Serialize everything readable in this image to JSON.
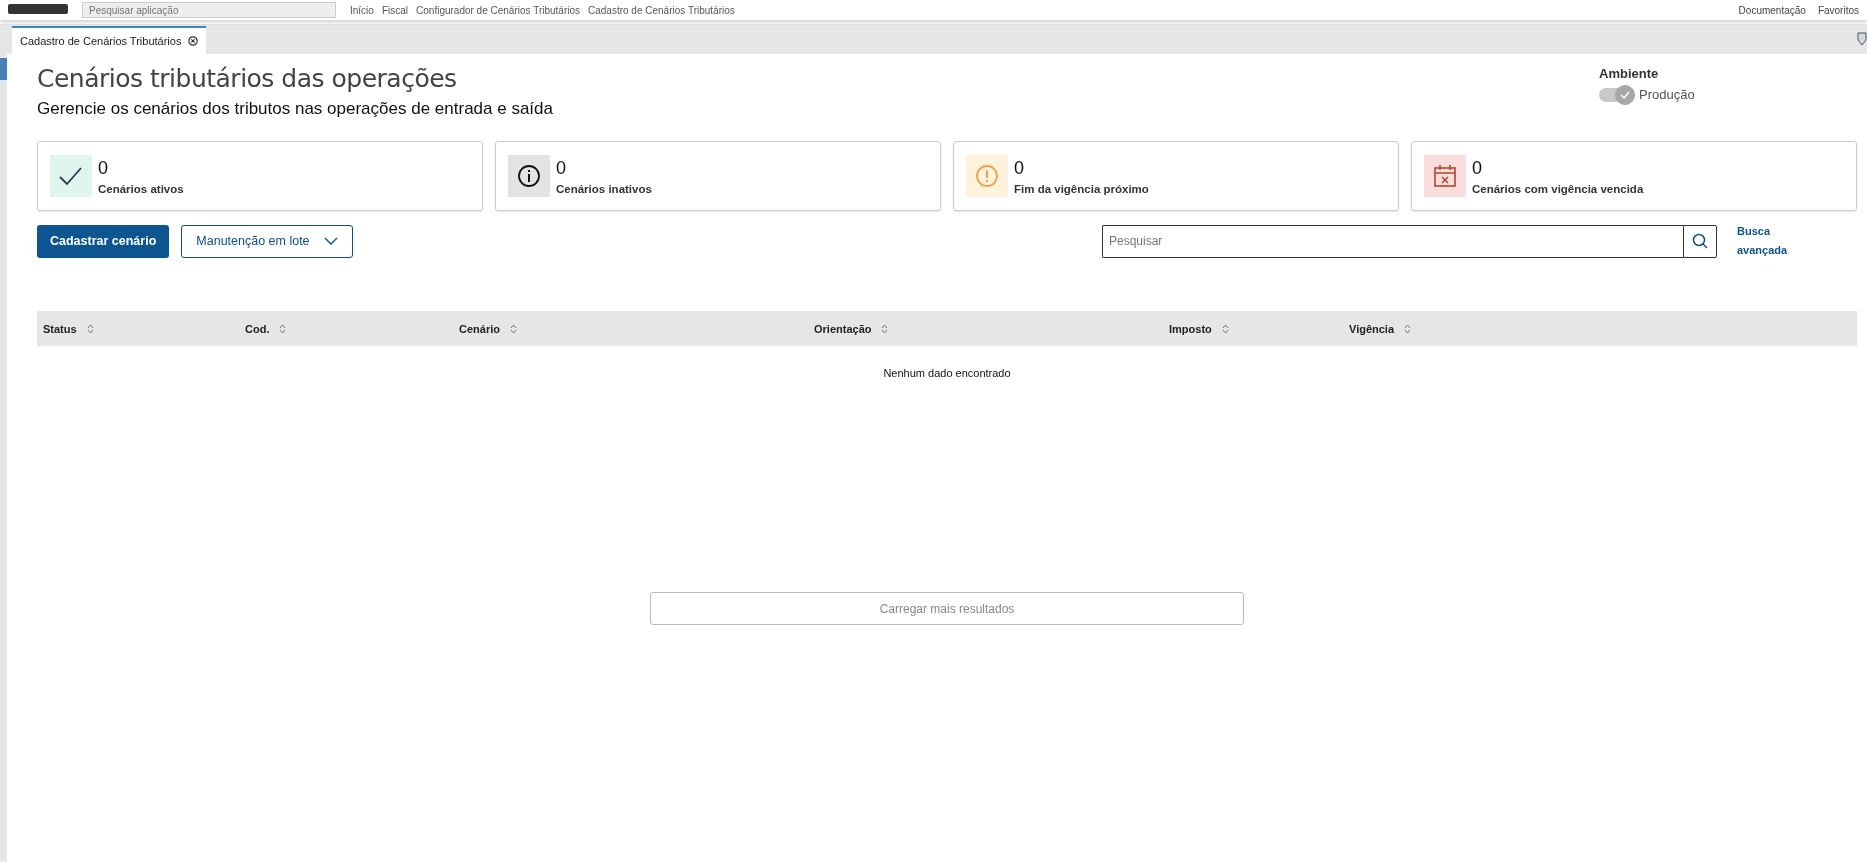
{
  "top_bar": {
    "search": {
      "placeholder": "Pesquisar aplicação"
    },
    "breadcrumbs": [
      "Início",
      "Fiscal",
      "Configurador de Cenários Tributários",
      "Cadastro de Cenários Tributários"
    ],
    "links": [
      "Documentação",
      "Favoritos"
    ]
  },
  "tabs": [
    {
      "label": "Cadastro de Cenários Tributários",
      "selected": true
    }
  ],
  "page": {
    "title": "Cenários tributários das operações",
    "subtitle": "Gerencie os cenários dos tributos nas operações de entrada e saída"
  },
  "environment": {
    "label": "Ambiente",
    "toggle": {
      "on": true,
      "label": "Produção"
    }
  },
  "summary_cards": [
    {
      "kind": "active",
      "count": "0",
      "label": "Cenários ativos"
    },
    {
      "kind": "inactive",
      "count": "0",
      "label": "Cenários inativos"
    },
    {
      "kind": "expiring",
      "count": "0",
      "label": "Fim da vigência próximo"
    },
    {
      "kind": "expired",
      "count": "0",
      "label": "Cenários com vigência vencida"
    }
  ],
  "actions": {
    "primary": "Cadastrar cenário",
    "dropdown": "Manutenção em lote"
  },
  "search": {
    "placeholder": "Pesquisar",
    "advanced_link": "Busca avançada"
  },
  "table": {
    "columns": [
      "Status",
      "Cod.",
      "Cenário",
      "Orientação",
      "Imposto",
      "Vigência"
    ],
    "empty_message": "Nenhum dado encontrado"
  },
  "load_more": {
    "label": "Carregar mais resultados",
    "disabled": true
  }
}
